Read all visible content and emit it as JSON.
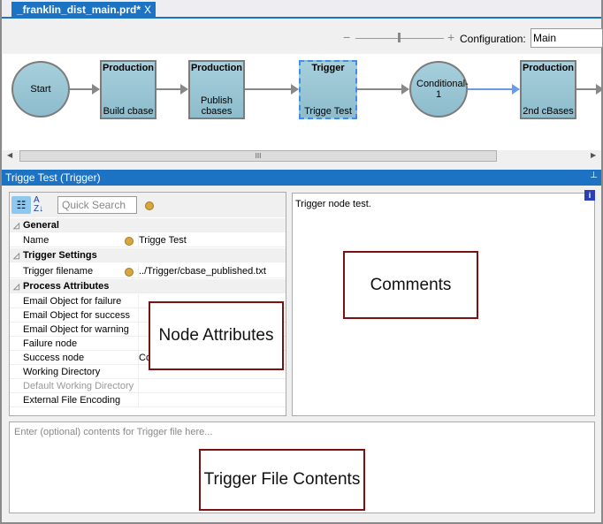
{
  "tab": {
    "title": "_franklin_dist_main.prd*",
    "close": "X"
  },
  "toolbar": {
    "zoom_minus": "−",
    "zoom_plus": "+",
    "zoom_level": 0.5,
    "config_label": "Configuration:",
    "config_value": "Main"
  },
  "workflow": {
    "nodes": [
      {
        "type": "",
        "label": "Start",
        "shape": "circle"
      },
      {
        "type": "Production",
        "label": "Build cbase"
      },
      {
        "type": "Production",
        "label": "Publish cbases"
      },
      {
        "type": "Trigger",
        "label": "Trigge Test",
        "selected": true
      },
      {
        "type": "",
        "label": "Conditional-1",
        "shape": "circle"
      },
      {
        "type": "Production",
        "label": "2nd cBases"
      }
    ],
    "scroll_grip": "III"
  },
  "panel": {
    "title": "Trigge Test (Trigger)",
    "pin": "⊥"
  },
  "props": {
    "search_placeholder": "Quick Search",
    "categories": [
      {
        "name": "General"
      },
      {
        "name": "Trigger Settings"
      },
      {
        "name": "Process Attributes"
      }
    ],
    "rows": [
      {
        "name": "Name",
        "value": "Trigge Test"
      },
      {
        "name": "Trigger filename",
        "value": "../Trigger/cbase_published.txt"
      },
      {
        "name": "Email Object for failure",
        "value": ""
      },
      {
        "name": "Email Object for success",
        "value": ""
      },
      {
        "name": "Email Object for warning",
        "value": ""
      },
      {
        "name": "Failure node",
        "value": ""
      },
      {
        "name": "Success node",
        "value": "Co"
      },
      {
        "name": "Working Directory",
        "value": ""
      },
      {
        "name": "Default Working Directory",
        "value": ""
      },
      {
        "name": "External File Encoding",
        "value": ""
      }
    ]
  },
  "comments": {
    "text": "Trigger node test.",
    "info": "i"
  },
  "trigger_file": {
    "placeholder": "Enter (optional) contents for Trigger file here..."
  },
  "annotations": {
    "node_attributes": "Node Attributes",
    "comments": "Comments",
    "trigger_file_contents": "Trigger File Contents"
  }
}
